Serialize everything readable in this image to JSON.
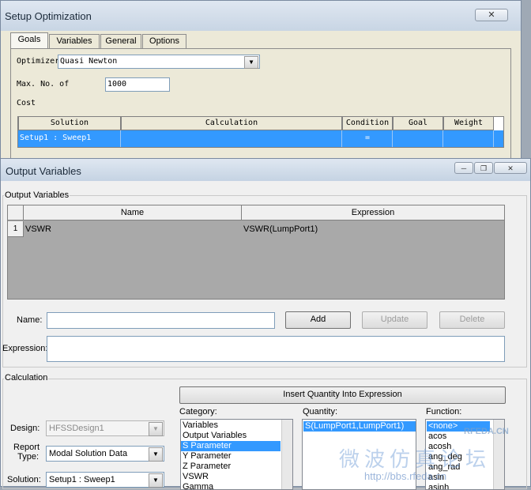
{
  "setup_window": {
    "title": "Setup Optimization",
    "close": "✕",
    "tabs": [
      "Goals",
      "Variables",
      "General",
      "Options"
    ],
    "optimizer_label": "Optimizer",
    "optimizer_value": "Quasi Newton",
    "max_label": "Max. No. of",
    "max_value": "1000",
    "cost_label": "Cost",
    "grid": {
      "headers": [
        "Solution",
        "Calculation",
        "Condition",
        "Goal",
        "Weight"
      ],
      "row": [
        "Setup1 : Sweep1",
        "",
        "=",
        "",
        ""
      ]
    }
  },
  "output_window": {
    "title": "Output Variables",
    "controls": {
      "minimize": "─",
      "restore": "❐",
      "close": "✕"
    },
    "group_output": "Output Variables",
    "table": {
      "headers": [
        "Name",
        "Expression"
      ],
      "rows": [
        {
          "num": "1",
          "name": "VSWR",
          "expression": "VSWR(LumpPort1)"
        }
      ]
    },
    "name_label": "Name:",
    "name_value": "",
    "expression_label": "Expression:",
    "expression_value": "",
    "buttons": {
      "add": "Add",
      "update": "Update",
      "delete": "Delete"
    },
    "group_calc": "Calculation",
    "insert_button": "Insert Quantity Into Expression",
    "design_label": "Design:",
    "design_value": "HFSSDesign1",
    "report_type_label_1": "Report",
    "report_type_label_2": "Type:",
    "report_type_value": "Modal Solution Data",
    "solution_label": "Solution:",
    "solution_value": "Setup1 : Sweep1",
    "category_label": "Category:",
    "category_items": [
      "Variables",
      "Output Variables",
      "S Parameter",
      "Y Parameter",
      "Z Parameter",
      "VSWR",
      "Gamma"
    ],
    "category_selected": 2,
    "quantity_label": "Quantity:",
    "quantity_items": [
      "S(LumpPort1,LumpPort1)"
    ],
    "function_label": "Function:",
    "function_items": [
      "<none>",
      "acos",
      "acosh",
      "ang_deg",
      "ang_rad",
      "asin",
      "asinh"
    ],
    "function_selected": 0,
    "watermark_cn": "微波仿真论坛",
    "watermark_url": "http://bbs.rfeda.cn",
    "watermark_logo": "RFEDA.CN"
  }
}
